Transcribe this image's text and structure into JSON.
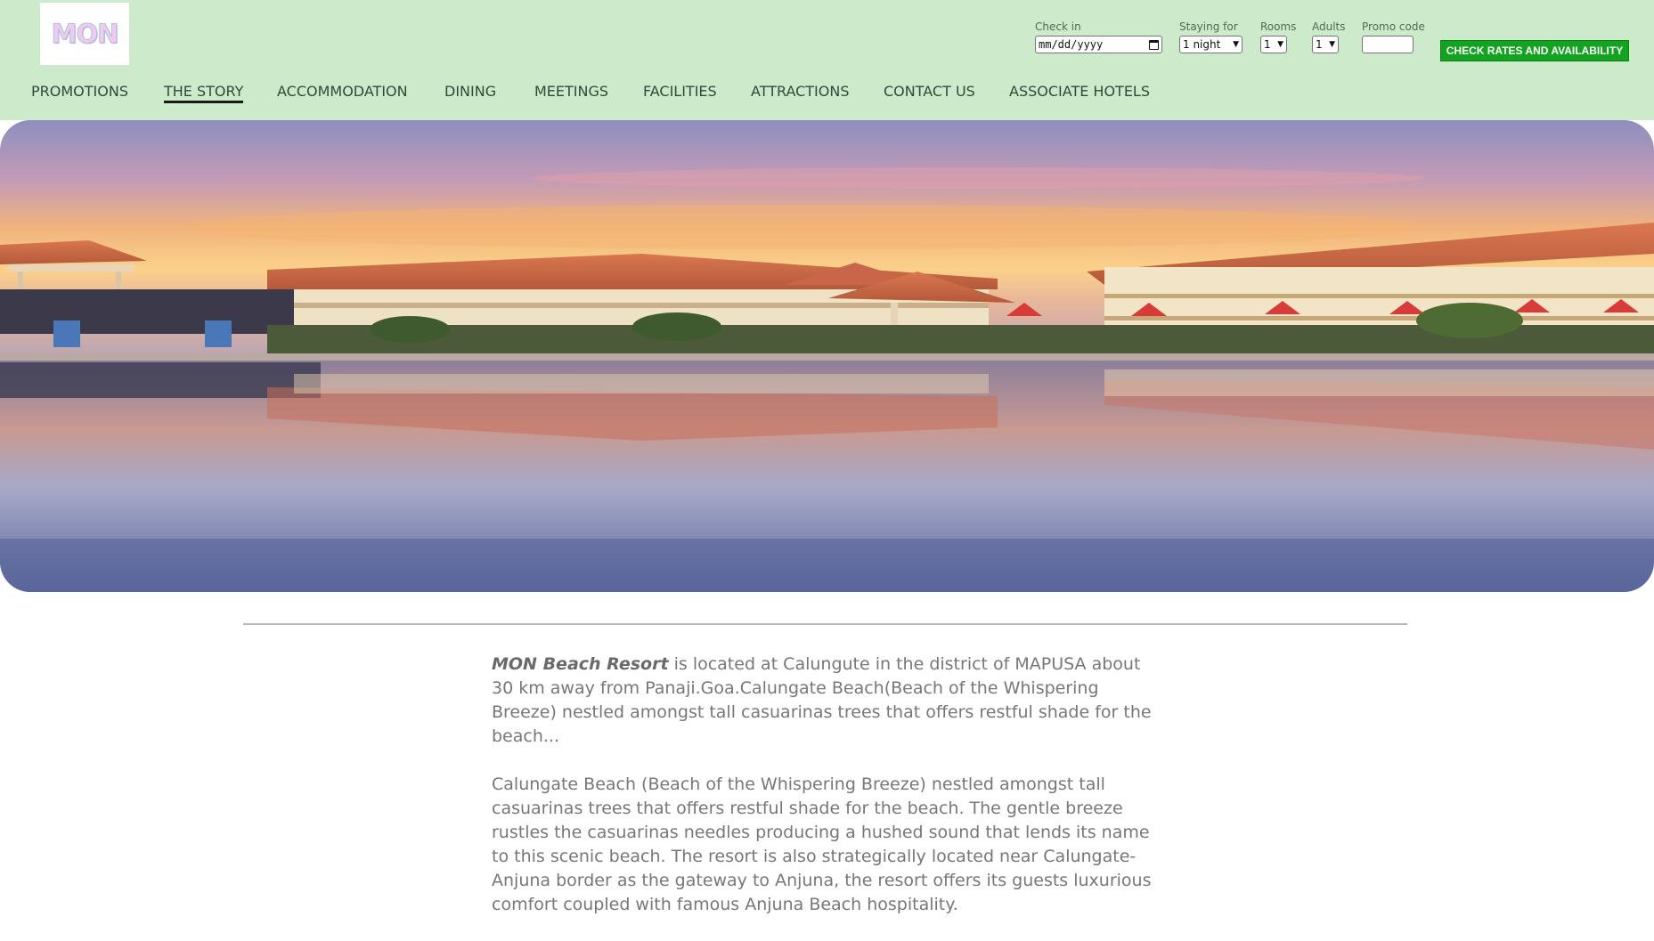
{
  "logo": {
    "text": "MON"
  },
  "booking": {
    "checkin_label": "Check in",
    "checkin_placeholder": "mm/dd/yyyy",
    "staying_label": "Staying for",
    "staying_value": "1 night",
    "rooms_label": "Rooms",
    "rooms_value": "1",
    "adults_label": "Adults",
    "adults_value": "1",
    "promo_label": "Promo code",
    "promo_value": "",
    "check_button": "CHECK RATES AND AVAILABILITY",
    "button_color": "#14a320"
  },
  "nav": {
    "items": [
      {
        "label": "PROMOTIONS"
      },
      {
        "label": "THE STORY"
      },
      {
        "label": "ACCOMMODATION"
      },
      {
        "label": "DINING"
      },
      {
        "label": "MEETINGS"
      },
      {
        "label": "FACILITIES"
      },
      {
        "label": "ATTRACTIONS"
      },
      {
        "label": "CONTACT US"
      },
      {
        "label": "ASSOCIATE HOTELS"
      }
    ],
    "active_index": 1
  },
  "colors": {
    "header_bg": "#cdebcb",
    "text": "#777777"
  },
  "content": {
    "brand": "MON Beach Resort",
    "p1_rest": " is located at Calungute in the district of MAPUSA about 30 km away from Panaji.Goa.Calungate Beach(Beach of the Whispering Breeze) nestled amongst tall casuarinas trees that offers restful shade for the beach...",
    "p2": "Calungate Beach (Beach of the Whispering Breeze) nestled amongst tall casuarinas trees that offers restful shade for the beach. The gentle breeze rustles the casuarinas needles producing a hushed sound that lends its name to this scenic beach. The resort is also strategically located near Calungate-Anjuna border as the gateway to Anjuna, the resort offers its guests luxurious comfort coupled with famous Anjuna Beach hospitality."
  }
}
